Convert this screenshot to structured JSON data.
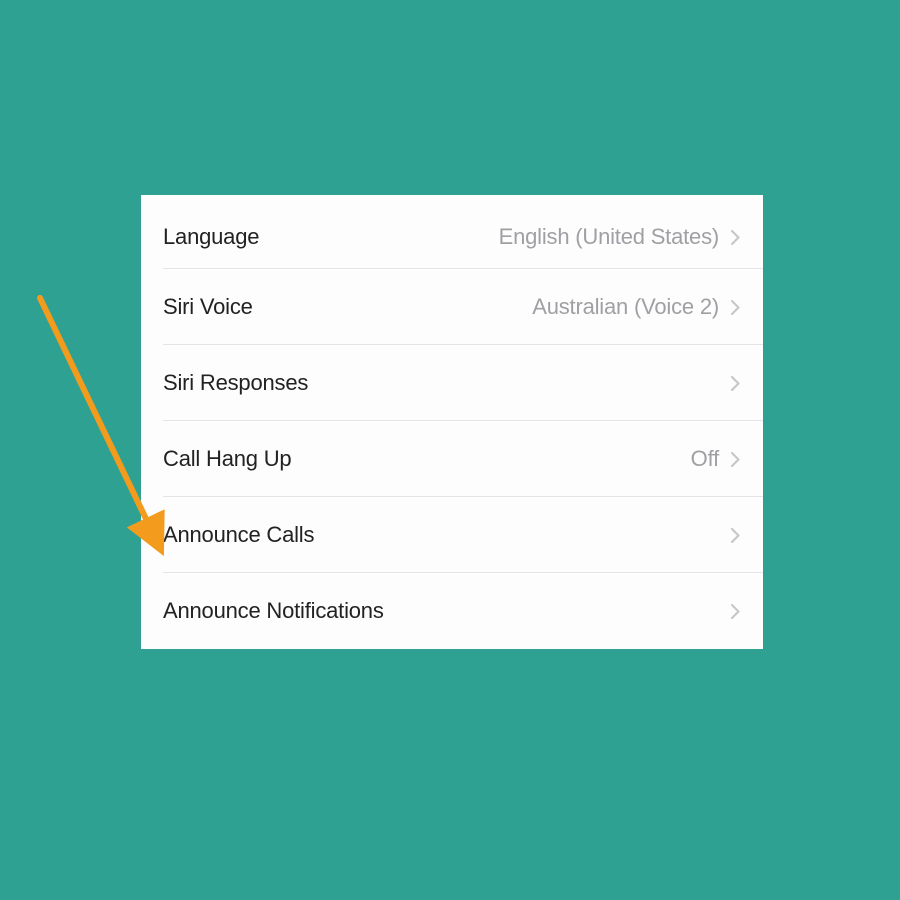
{
  "settings": {
    "rows": [
      {
        "label": "Language",
        "value": "English (United States)"
      },
      {
        "label": "Siri Voice",
        "value": "Australian (Voice 2)"
      },
      {
        "label": "Siri Responses",
        "value": ""
      },
      {
        "label": "Call Hang Up",
        "value": "Off"
      },
      {
        "label": "Announce Calls",
        "value": ""
      },
      {
        "label": "Announce Notifications",
        "value": ""
      }
    ]
  },
  "colors": {
    "background": "#2ea193",
    "arrow": "#f29b1d"
  }
}
